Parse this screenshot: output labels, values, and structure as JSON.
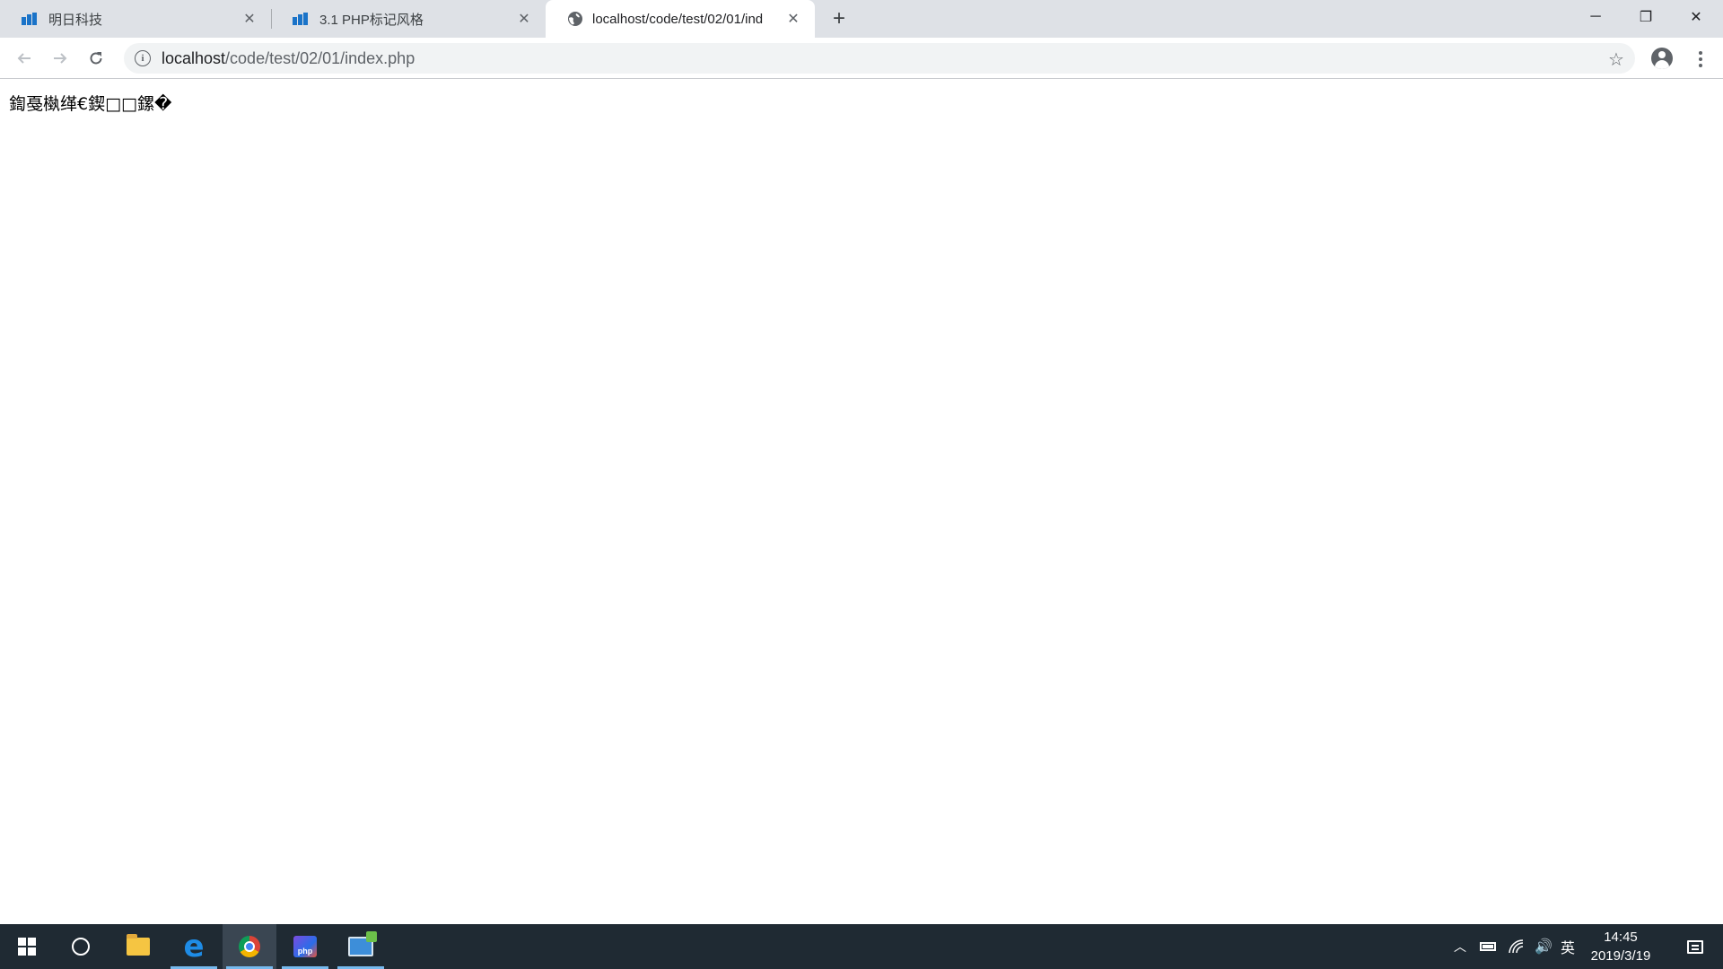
{
  "browser": {
    "tabs": [
      {
        "label": "明日科技",
        "icon": "mr-logo-icon",
        "active": false
      },
      {
        "label": "3.1 PHP标记风格",
        "icon": "mr-logo-icon",
        "active": false
      },
      {
        "label": "localhost/code/test/02/01/ind",
        "icon": "globe-icon",
        "active": true
      }
    ],
    "address": {
      "host": "localhost",
      "path": "/code/test/02/01/index.php"
    },
    "window_controls": {
      "minimize": "─",
      "restore": "❐",
      "close": "✕"
    },
    "new_tab": "+"
  },
  "page": {
    "text": "鍧戞槸缂€鍥□□鏍�"
  },
  "taskbar": {
    "apps": [
      "start-button",
      "cortana-search",
      "file-explorer",
      "edge",
      "chrome",
      "phpstorm",
      "remote-desktop"
    ],
    "active_app": "chrome",
    "tray": {
      "ime": "英",
      "volume": "🔊",
      "chevron": "︿"
    },
    "clock": {
      "time": "14:45",
      "date": "2019/3/19"
    }
  },
  "colors": {
    "tabstrip_bg": "#dee1e6",
    "taskbar_bg": "#1f2a33",
    "active_tab_bg": "#ffffff",
    "taskbar_accent": "#76b9ed"
  }
}
